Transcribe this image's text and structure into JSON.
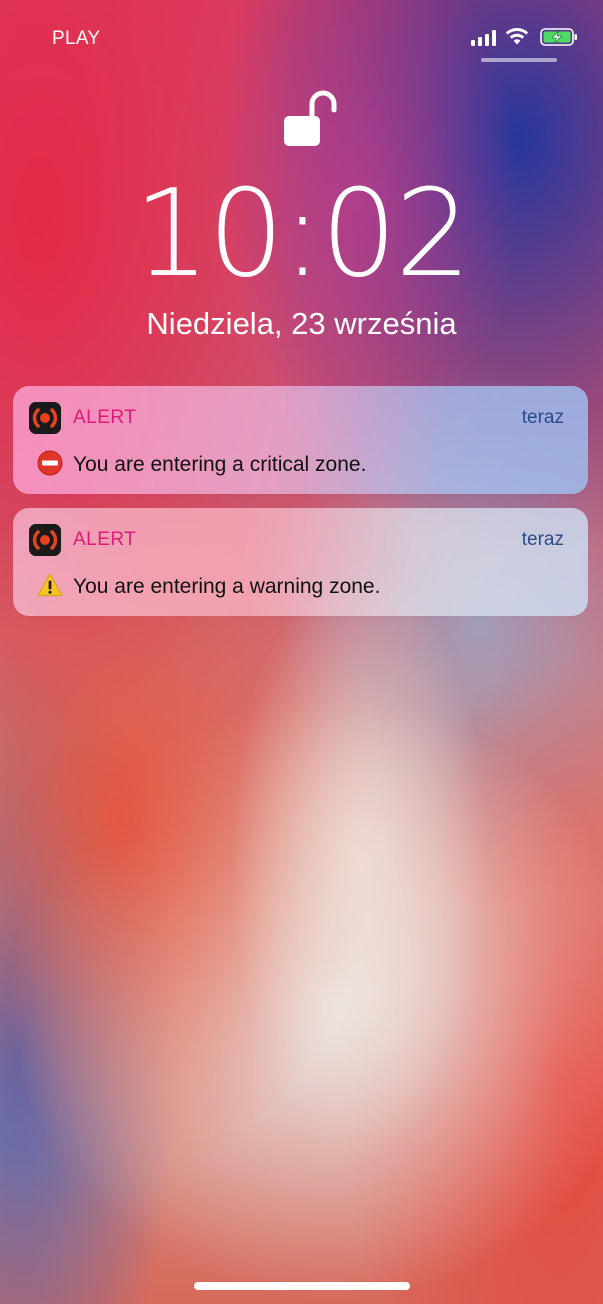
{
  "status_bar": {
    "carrier": "PLAY",
    "signal_bars": 4,
    "signal_icon": "cellular-signal-icon",
    "wifi_icon": "wifi-icon",
    "battery_icon": "battery-charging-icon",
    "battery_color": "#4cd964"
  },
  "lock_screen": {
    "lock_icon": "unlocked-padlock-icon",
    "time": "10:02",
    "date": "Niedziela, 23 września"
  },
  "notifications": [
    {
      "app_name": "ALERT",
      "time": "teraz",
      "icon": "no-entry-emoji-icon",
      "message": "You are entering a critical zone."
    },
    {
      "app_name": "ALERT",
      "time": "teraz",
      "icon": "warning-emoji-icon",
      "message": "You are entering a warning zone."
    }
  ],
  "colors": {
    "app_name": "#e0197a",
    "timestamp": "#2b4a8a",
    "app_icon_bg": "#1a1a1a",
    "app_icon_accent": "#e8421e"
  }
}
